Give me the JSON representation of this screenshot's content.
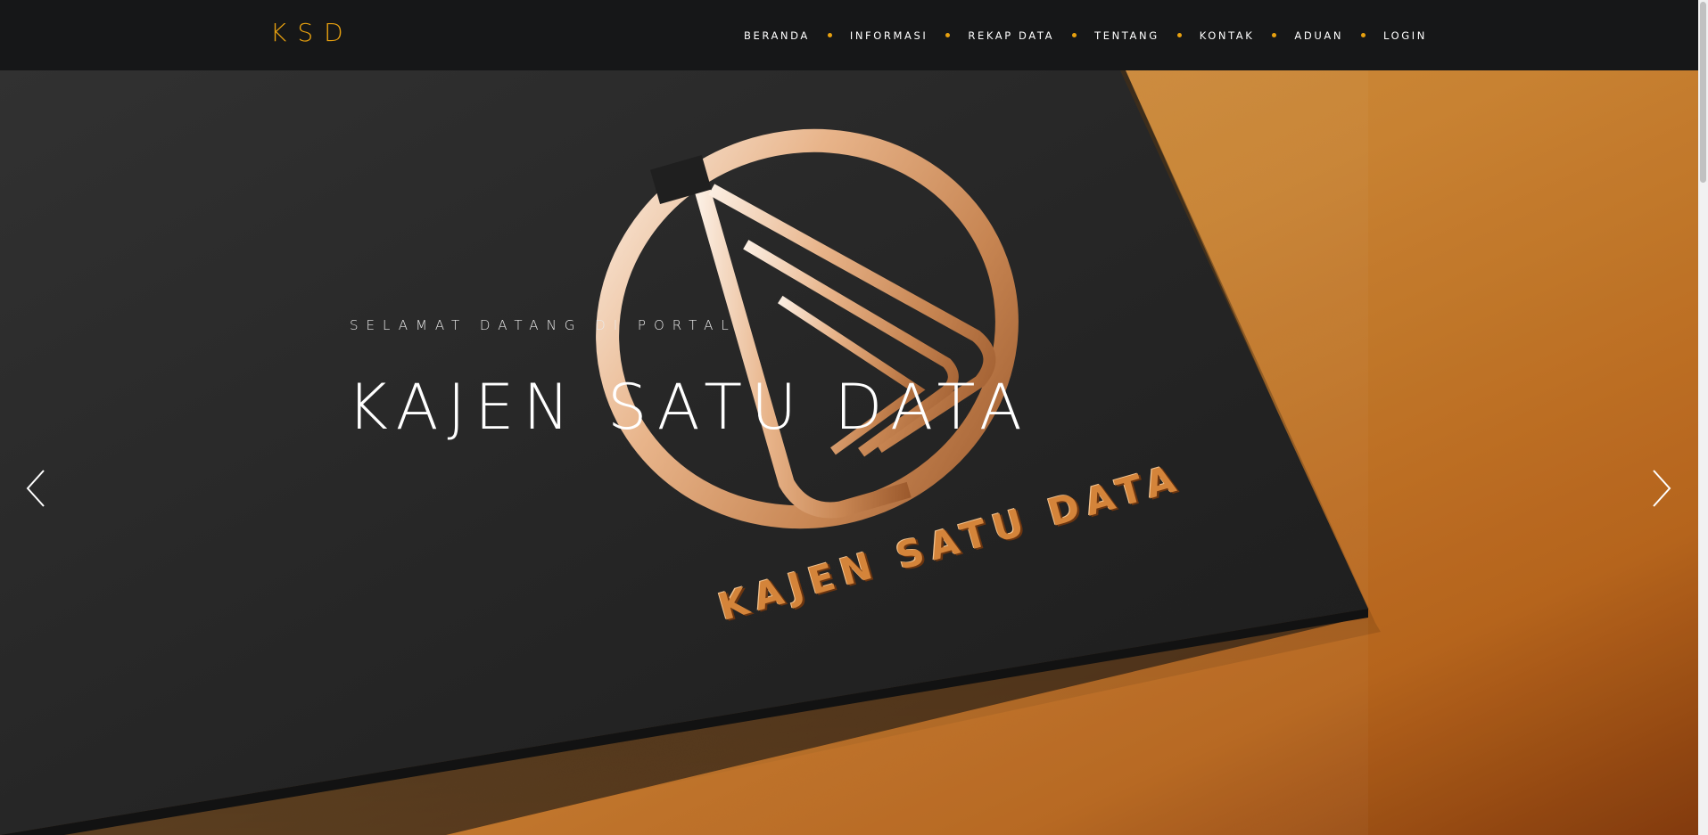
{
  "navbar": {
    "brand": "KSD",
    "items": [
      {
        "label": "BERANDA"
      },
      {
        "label": "INFORMASI"
      },
      {
        "label": "REKAP DATA"
      },
      {
        "label": "TENTANG"
      },
      {
        "label": "KONTAK"
      },
      {
        "label": "ADUAN"
      },
      {
        "label": "LOGIN"
      }
    ]
  },
  "hero": {
    "subtitle": "SELAMAT DATANG DI PORTAL",
    "title": "KAJEN SATU DATA",
    "card_text": "KAJEN SATU DATA"
  },
  "icons": {
    "prev": "chevron-left-icon",
    "next": "chevron-right-icon",
    "logo": "kajen-satu-data-logo"
  },
  "colors": {
    "accent": "#e8a10f",
    "navbar_bg": "#161718",
    "card_dark": "#1c1c1c",
    "copper": "#c97a2e"
  }
}
